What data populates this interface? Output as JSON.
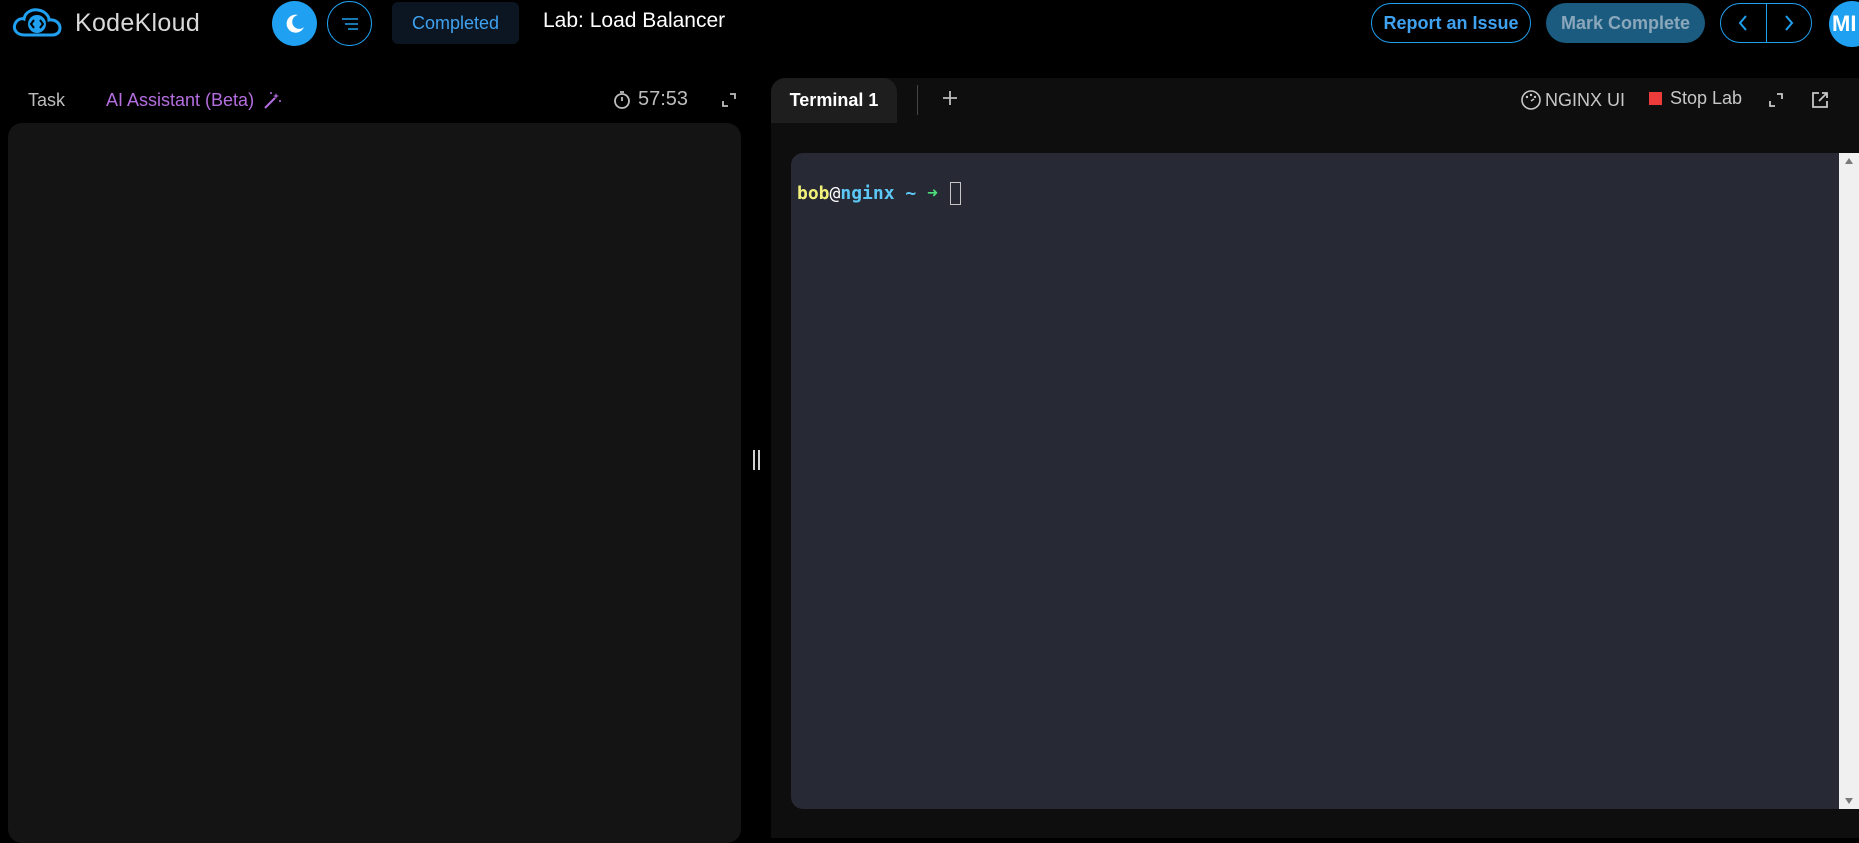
{
  "brand": {
    "name": "KodeKloud",
    "logo_color": "#1fa0f0"
  },
  "header": {
    "status": "Completed",
    "lab_title": "Lab: Load Balancer",
    "report_label": "Report an Issue",
    "complete_label": "Mark Complete",
    "avatar_initials": "MI"
  },
  "left_panel": {
    "tabs": [
      {
        "label": "Task",
        "active": false
      },
      {
        "label": "AI Assistant (Beta)",
        "active": false
      }
    ],
    "timer": "57:53"
  },
  "right_panel": {
    "tabs": [
      {
        "label": "Terminal 1",
        "active": true
      }
    ],
    "nginx_ui_label": "NGINX UI",
    "stop_lab_label": "Stop Lab"
  },
  "terminal": {
    "user": "bob",
    "at": "@",
    "host": "nginx",
    "path": "~",
    "arrow": "➜"
  },
  "colors": {
    "accent": "#1fa0f0",
    "ai_purple": "#b46ee0",
    "stop_red": "#ec3b3b",
    "terminal_bg": "#272935",
    "prompt_user": "#f2f27a",
    "prompt_host": "#5cc8f5",
    "prompt_arrow": "#4de07a"
  }
}
